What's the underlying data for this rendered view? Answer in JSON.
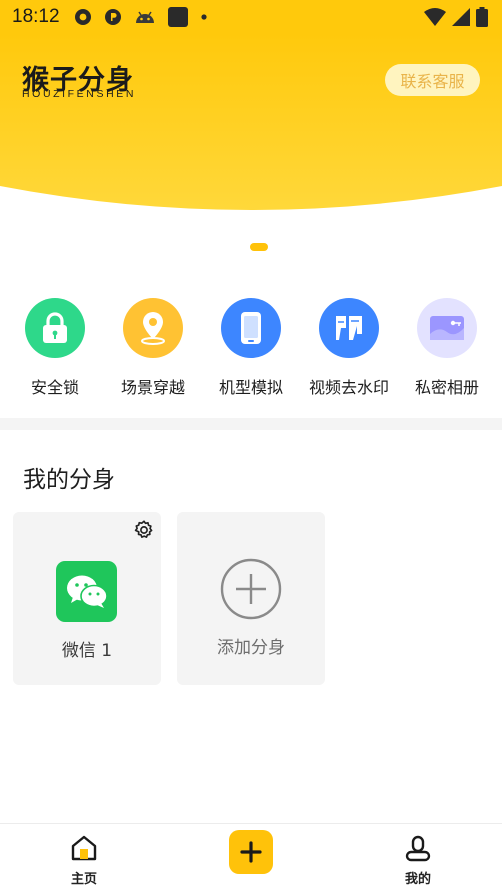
{
  "status_bar": {
    "time": "18:12",
    "icons": [
      "app-o-icon",
      "app-p-icon",
      "android-icon",
      "square-app-icon",
      "dot-icon",
      "wifi-icon",
      "signal-icon",
      "battery-icon"
    ]
  },
  "header": {
    "logo_cn": "猴子分身",
    "logo_en": "HOUZIFENSHEN",
    "contact_label": "联系客服"
  },
  "banner": {
    "page_indicator": {
      "active_index": 0,
      "count": 1
    }
  },
  "features": [
    {
      "label": "安全锁",
      "icon": "lock-icon",
      "color": "#2ed88a"
    },
    {
      "label": "场景穿越",
      "icon": "location-pin-icon",
      "color": "#ffc233"
    },
    {
      "label": "机型模拟",
      "icon": "phone-icon",
      "color": "#3d86ff"
    },
    {
      "label": "视频去水印",
      "icon": "watermark-icon",
      "color": "#3d86ff"
    },
    {
      "label": "私密相册",
      "icon": "album-icon",
      "color": "#b9b6ff"
    }
  ],
  "my_clones": {
    "title": "我的分身",
    "items": [
      {
        "label": "微信 1",
        "icon": "wechat-icon",
        "settings_icon": "gear-icon"
      }
    ],
    "add_label": "添加分身"
  },
  "bottom_nav": {
    "home_label": "主页",
    "mine_label": "我的",
    "add_icon": "plus-icon",
    "accent": "#ffc20a"
  },
  "colors": {
    "brand_yellow": "#ffc90c",
    "contact_text": "#e9b44a"
  }
}
